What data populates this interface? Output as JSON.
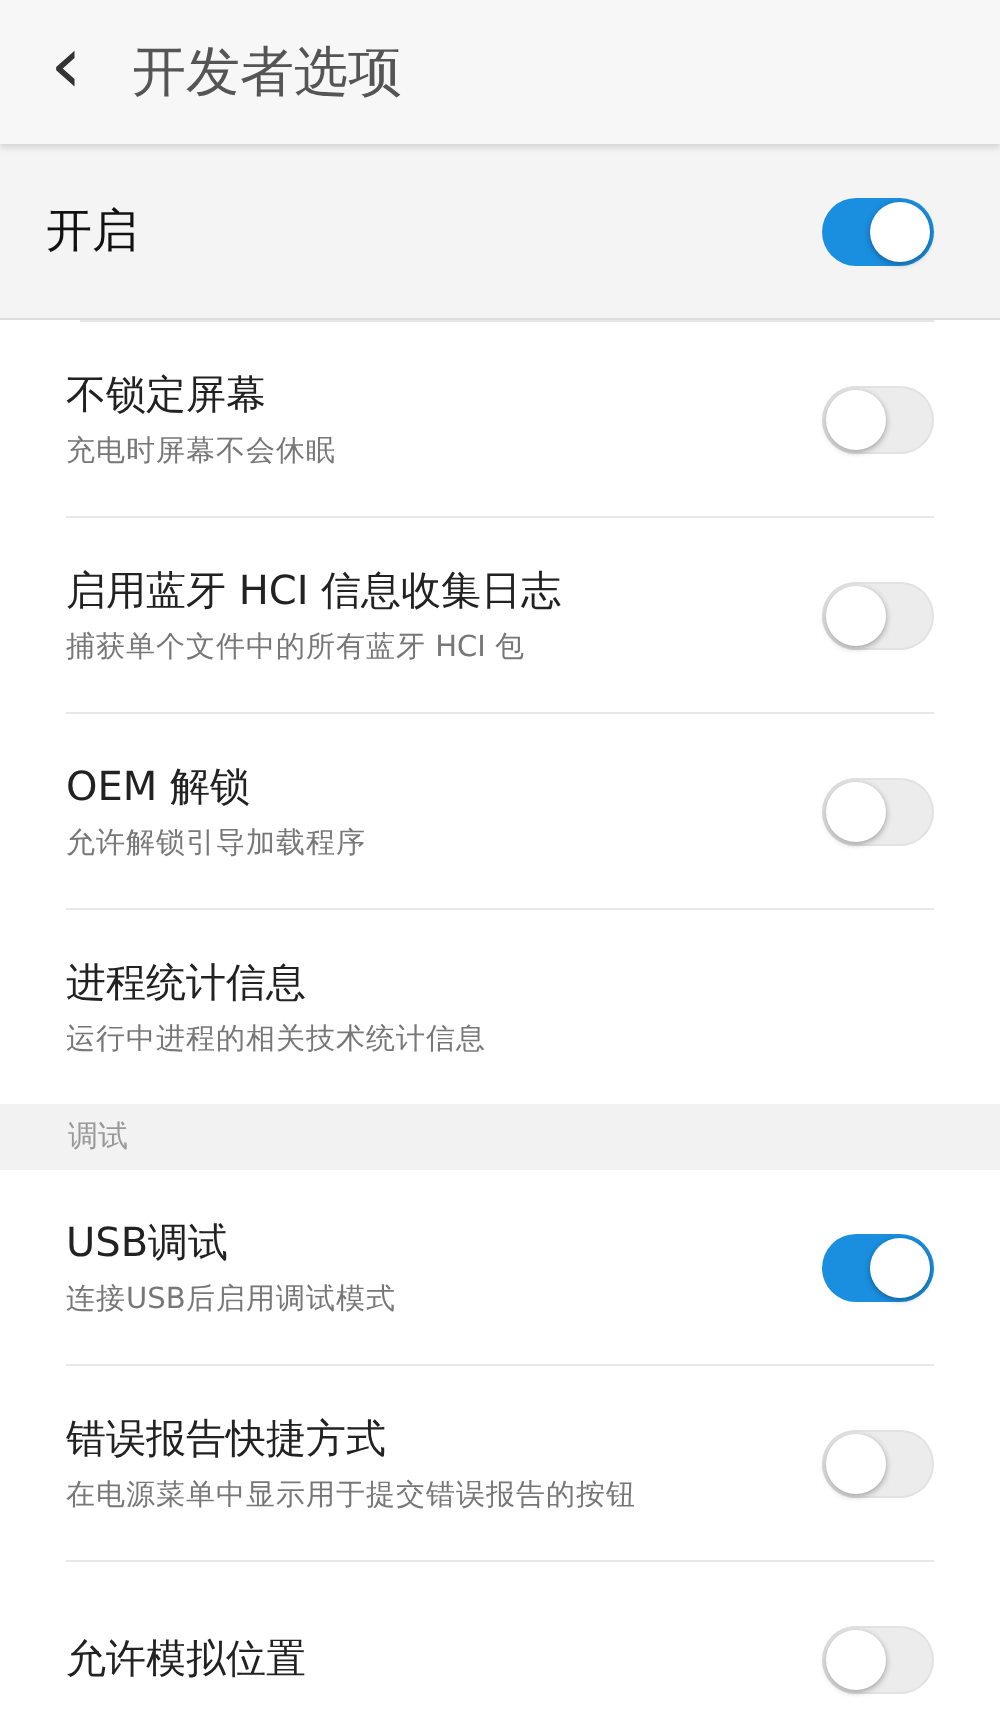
{
  "header": {
    "back": "‹",
    "title": "开发者选项"
  },
  "master": {
    "label": "开启",
    "on": true
  },
  "groups": [
    {
      "items": [
        {
          "kind": "toggle",
          "title": "不锁定屏幕",
          "subtitle": "充电时屏幕不会休眠",
          "on": false
        },
        {
          "kind": "toggle",
          "title": "启用蓝牙 HCI 信息收集日志",
          "subtitle": "捕获单个文件中的所有蓝牙 HCI 包",
          "on": false
        },
        {
          "kind": "toggle",
          "title": "OEM 解锁",
          "subtitle": "允许解锁引导加载程序",
          "on": false
        },
        {
          "kind": "plain",
          "title": "进程统计信息",
          "subtitle": "运行中进程的相关技术统计信息"
        }
      ]
    },
    {
      "header": "调试",
      "items": [
        {
          "kind": "toggle",
          "title": "USB调试",
          "subtitle": "连接USB后启用调试模式",
          "on": true
        },
        {
          "kind": "toggle",
          "title": "错误报告快捷方式",
          "subtitle": "在电源菜单中显示用于提交错误报告的按钮",
          "on": false
        },
        {
          "kind": "toggle",
          "title": "允许模拟位置",
          "on": false
        }
      ]
    }
  ]
}
